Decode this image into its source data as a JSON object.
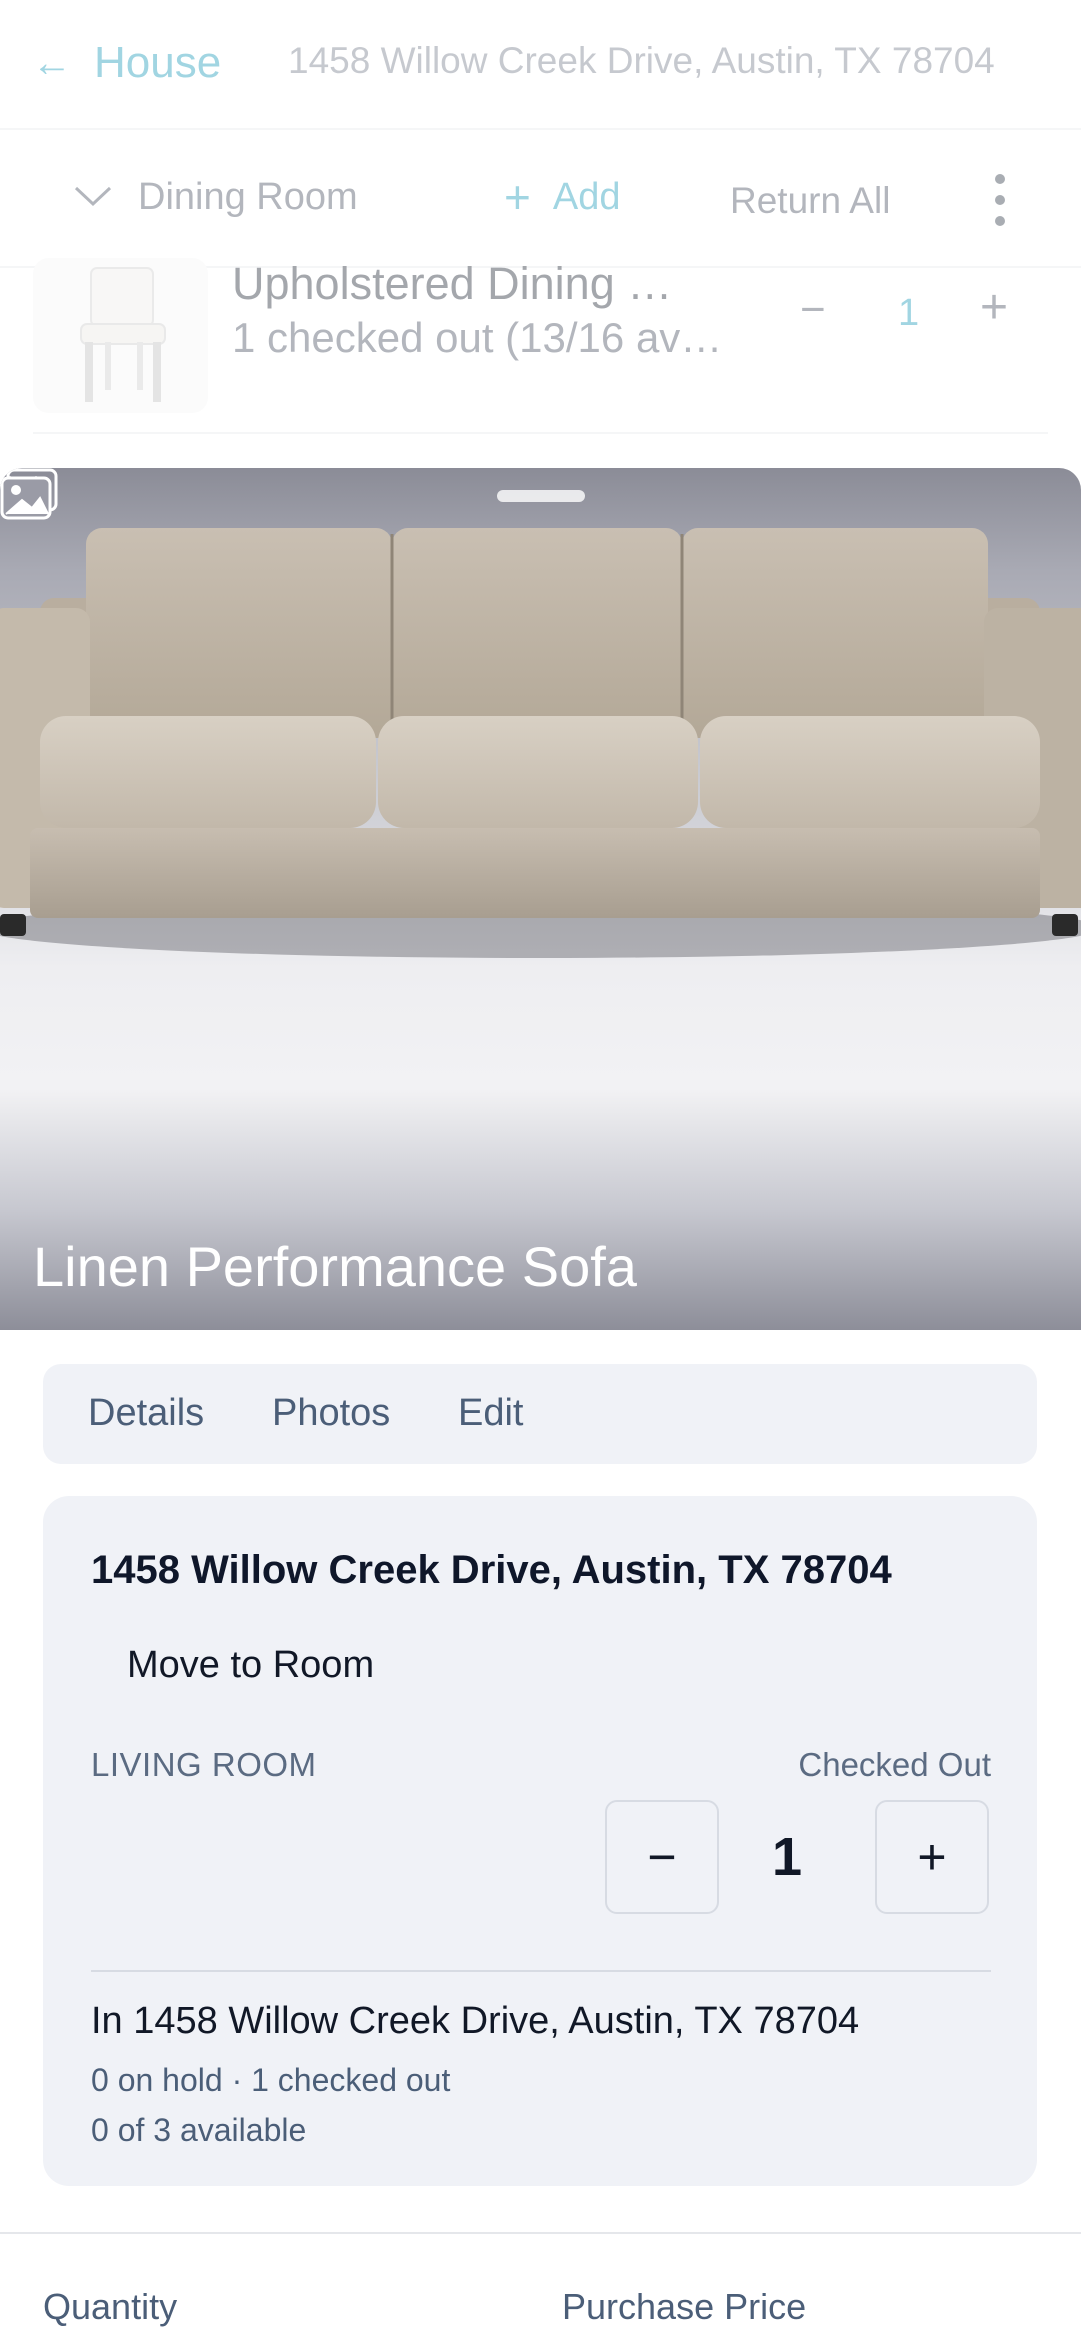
{
  "topbar": {
    "back_label": "House",
    "address": "1458 Willow Creek Drive, Austin, TX 78704"
  },
  "roombar": {
    "room_name": "Dining Room",
    "add_label": "Add",
    "return_all_label": "Return All"
  },
  "background_item": {
    "title": "Upholstered Dining …",
    "subtitle": "1 checked out (13/16 av…",
    "quantity": "1"
  },
  "sheet": {
    "title": "Linen Performance Sofa",
    "tabs": [
      {
        "label": "Details"
      },
      {
        "label": "Photos"
      },
      {
        "label": "Edit"
      }
    ],
    "card": {
      "address": "1458 Willow Creek Drive, Austin, TX 78704",
      "move_to_room_label": "Move to Room",
      "room": "LIVING ROOM",
      "status": "Checked Out",
      "quantity": "1",
      "location_line": "In 1458 Willow Creek Drive, Austin, TX 78704",
      "hold_line": "0 on hold · 1 checked out",
      "available_line": "0 of 3 available"
    },
    "fields": {
      "quantity_label": "Quantity",
      "purchase_price_label": "Purchase Price"
    }
  },
  "icons": {
    "back": "arrow-left-icon",
    "room_toggle": "chevron-down-icon",
    "add": "plus-icon",
    "more": "kebab-menu-icon",
    "close": "close-icon",
    "gallery": "gallery-icon",
    "decrement": "minus-icon",
    "increment": "plus-icon"
  },
  "colors": {
    "accent": "#0891b2",
    "card_background": "#f0f2f7",
    "muted_text": "#4b5e78"
  }
}
